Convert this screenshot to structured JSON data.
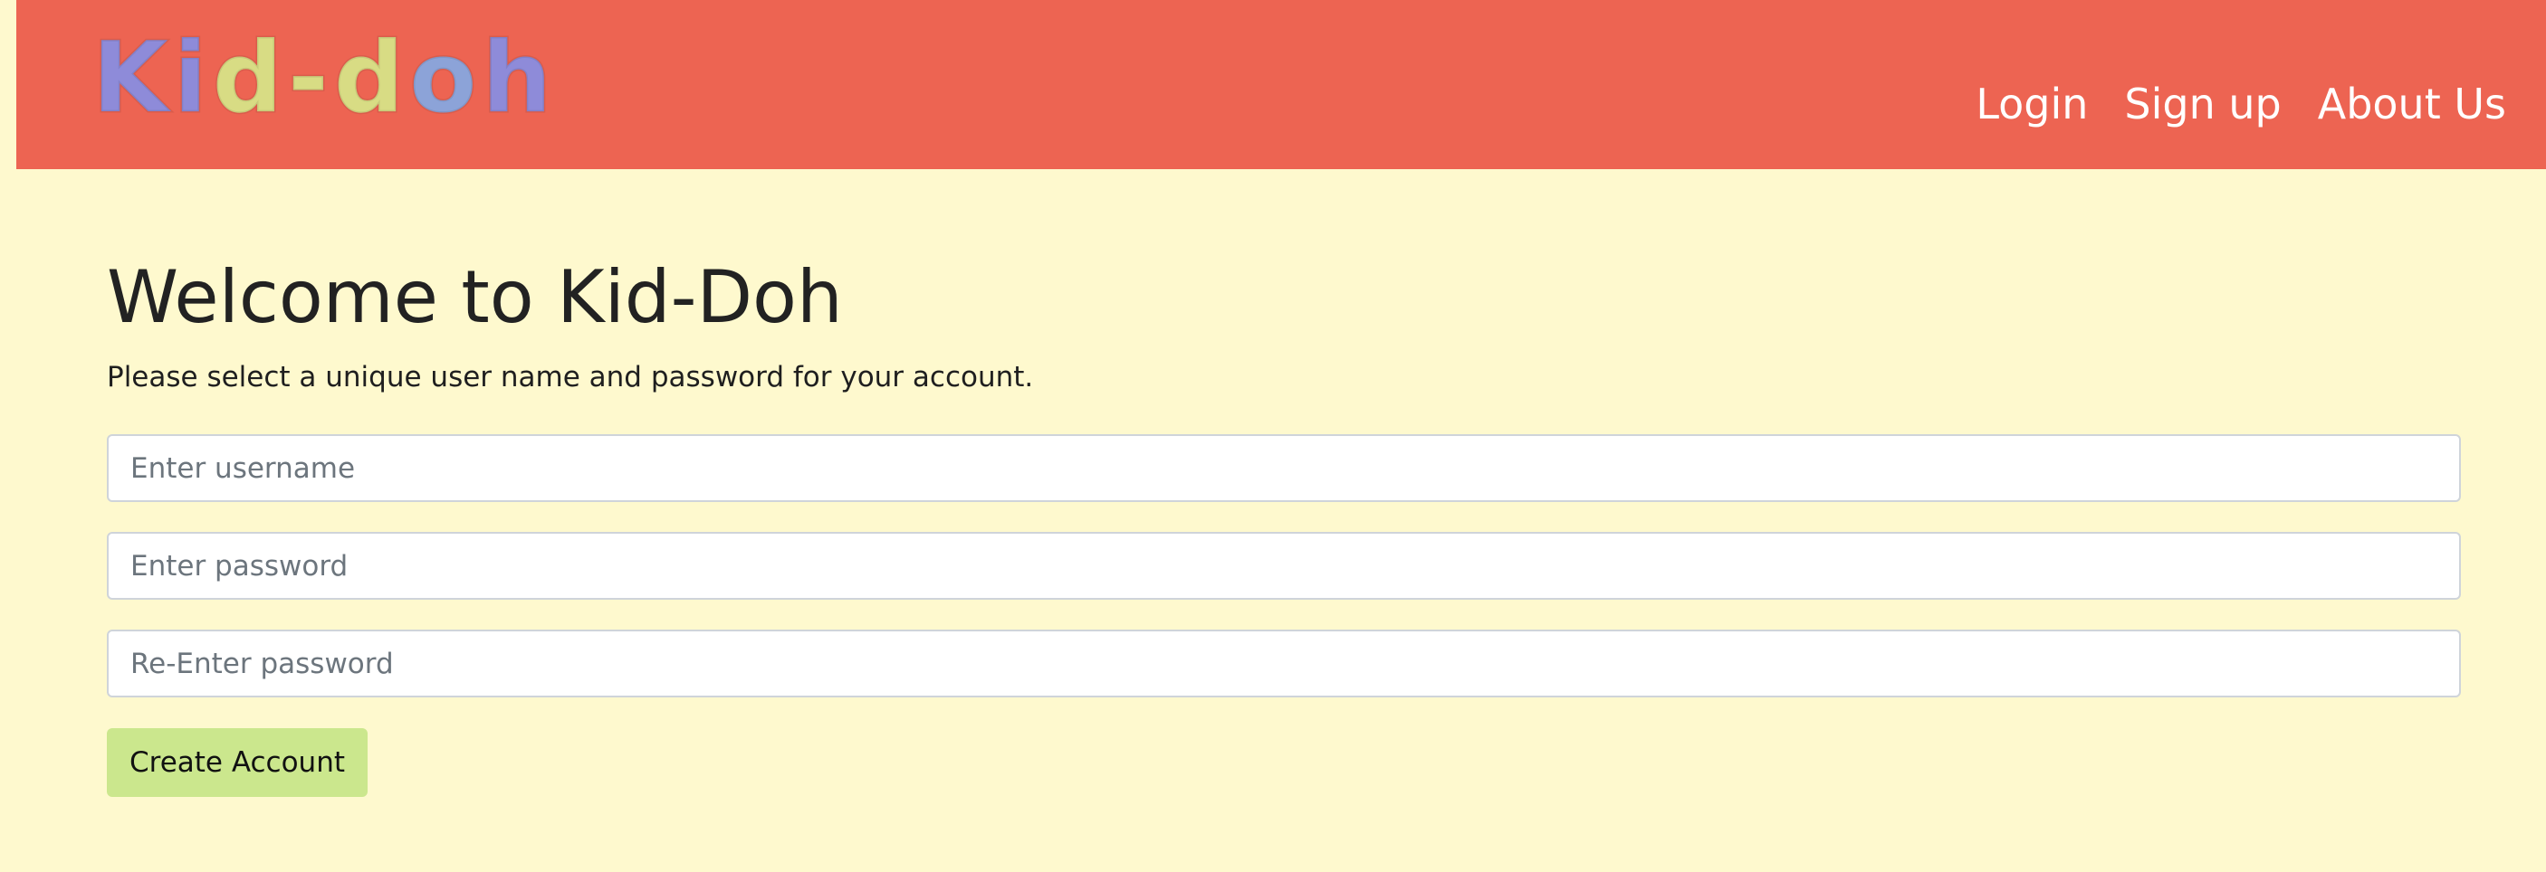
{
  "header": {
    "logo_letters": [
      {
        "char": "K",
        "color": "#8e8bd9"
      },
      {
        "char": "i",
        "color": "#8e8bd9"
      },
      {
        "char": "d",
        "color": "#d8dc84"
      },
      {
        "char": "-",
        "color": "#d8dc84"
      },
      {
        "char": "d",
        "color": "#d8dc84"
      },
      {
        "char": "o",
        "color": "#8ca3d8"
      },
      {
        "char": "h",
        "color": "#8e8bd9"
      }
    ],
    "nav": {
      "login": "Login",
      "signup": "Sign up",
      "about": "About Us"
    }
  },
  "main": {
    "title": "Welcome to Kid-Doh",
    "subtitle": "Please select a unique user name and password for your account.",
    "username_placeholder": "Enter username",
    "password_placeholder": "Enter password",
    "reenter_placeholder": "Re-Enter password",
    "create_button": "Create Account"
  },
  "colors": {
    "header_bg": "#ed6452",
    "page_bg": "#fef9ce",
    "button_bg": "#cbe78d",
    "nav_text": "#ffffff"
  }
}
